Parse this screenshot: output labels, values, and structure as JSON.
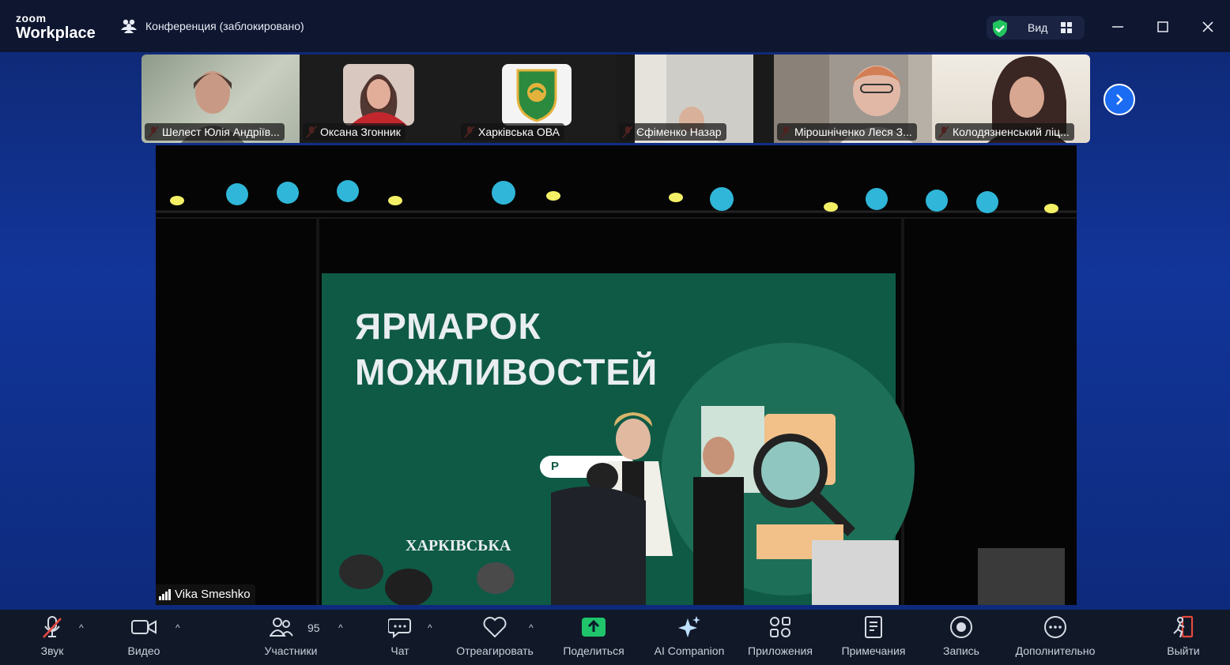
{
  "app": {
    "brand_top": "zoom",
    "brand_bottom": "Workplace"
  },
  "meeting": {
    "title": "Конференция (заблокировано)"
  },
  "view": {
    "label": "Вид"
  },
  "participants_strip": [
    {
      "name": "Шелест Юлія Андріїв..."
    },
    {
      "name": "Оксана Згонник"
    },
    {
      "name": "Харківська ОВА"
    },
    {
      "name": "Єфіменко Назар"
    },
    {
      "name": "Мірошніченко Леся З..."
    },
    {
      "name": "Колодязненський ліц..."
    }
  ],
  "main_video": {
    "speaker": "Vika Smeshko",
    "headline_line1": "ЯРМАРОК",
    "headline_line2": "МОЖЛИВОСТЕЙ",
    "org_name": "ХАРКІВСЬКА",
    "search_letter": "Р"
  },
  "toolbar": {
    "audio": "Звук",
    "video": "Видео",
    "participants": "Участники",
    "participants_count": "95",
    "chat": "Чат",
    "react": "Отреагировать",
    "share": "Поделиться",
    "ai": "AI Companion",
    "apps": "Приложения",
    "notes": "Примечания",
    "record": "Запись",
    "more": "Дополнительно",
    "leave": "Выйти"
  },
  "colors": {
    "accent": "#1b6cf2",
    "share_green": "#1fc46b",
    "leave_red": "#e5483f",
    "muted_red": "#e5483f"
  }
}
